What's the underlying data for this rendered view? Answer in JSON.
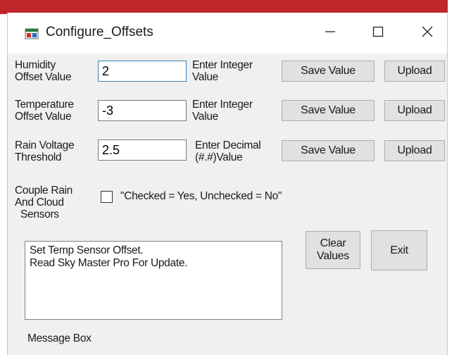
{
  "window": {
    "title": "Configure_Offsets",
    "controls": {
      "minimize": "minimize",
      "maximize": "maximize",
      "close": "close"
    }
  },
  "humidity": {
    "label_line1": "Humidity",
    "label_line2": "Offset Value",
    "value": "2",
    "hint_line1": "Enter Integer",
    "hint_line2": "Value",
    "save_label": "Save Value",
    "upload_label": "Upload"
  },
  "temperature": {
    "label_line1": "Temperature",
    "label_line2": "Offset Value",
    "value": "-3",
    "hint_line1": "Enter Integer",
    "hint_line2": "Value",
    "save_label": "Save Value",
    "upload_label": "Upload"
  },
  "rain": {
    "label_line1": "Rain Voltage",
    "label_line2": "Threshold",
    "value": "2.5",
    "hint_line1": "Enter Decimal",
    "hint_line2": "(#.#)Value",
    "save_label": "Save Value",
    "upload_label": "Upload"
  },
  "couple": {
    "label_line1": "Couple Rain",
    "label_line2": "And Cloud",
    "label_line3": "Sensors",
    "checked": false,
    "hint": "\"Checked = Yes,  Unchecked = No\""
  },
  "messages": {
    "lines": [
      "Set Temp Sensor Offset.",
      "Read Sky Master Pro For Update."
    ],
    "label": "Message Box"
  },
  "actions": {
    "clear_line1": "Clear",
    "clear_line2": "Values",
    "exit_label": "Exit"
  },
  "colors": {
    "accent_strip": "#c0272d",
    "window_bg": "#f0f0f0",
    "button_bg": "#e1e1e1"
  }
}
